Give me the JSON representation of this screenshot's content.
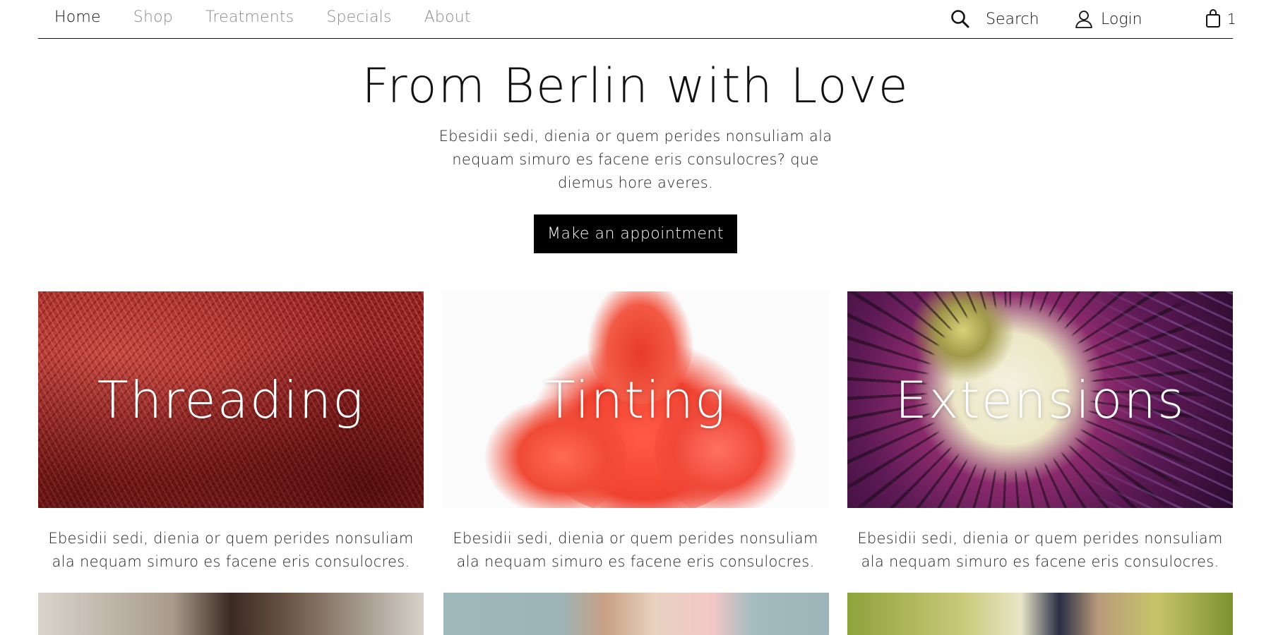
{
  "nav": {
    "links": [
      "Home",
      "Shop",
      "Treatments",
      "Specials",
      "About"
    ],
    "search_label": "Search",
    "login_label": "Login",
    "cart_count": "1"
  },
  "hero": {
    "title": "From Berlin with Love",
    "text": "Ebesidii sedi, dienia or quem perides nonsuliam ala nequam simuro es facene eris consulocres? que diemus hore averes.",
    "cta_label": "Make an appointment"
  },
  "cards": [
    {
      "title": "Threading",
      "text": "Ebesidii sedi, dienia or quem perides nonsuliam ala nequam simuro es facene eris consulocres."
    },
    {
      "title": "Tinting",
      "text": "Ebesidii sedi, dienia or quem perides nonsuliam ala nequam simuro es facene eris consulocres."
    },
    {
      "title": "Extensions",
      "text": "Ebesidii sedi, dienia or quem perides nonsuliam ala nequam simuro es facene eris consulocres."
    }
  ],
  "colors": {
    "text": "#111111",
    "nav_dim": "#8a8a8a",
    "button_bg": "#000000",
    "button_text": "#ffffff"
  },
  "icons": {
    "search": "search-icon",
    "login": "user-icon",
    "cart": "shopping-bag-icon"
  }
}
